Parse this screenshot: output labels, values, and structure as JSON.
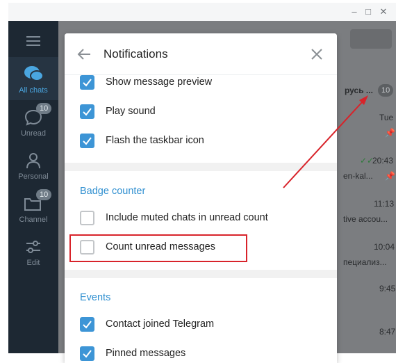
{
  "window": {
    "minimize_icon": "minimize-icon",
    "maximize_icon": "maximize-icon",
    "close_icon": "close-icon"
  },
  "sidebar": {
    "items": [
      {
        "label": "All chats",
        "icon": "chats-icon",
        "badge": ""
      },
      {
        "label": "Unread",
        "icon": "chat-bubble-icon",
        "badge": "10"
      },
      {
        "label": "Personal",
        "icon": "person-icon",
        "badge": ""
      },
      {
        "label": "Channel",
        "icon": "folder-icon",
        "badge": "10"
      },
      {
        "label": "Edit",
        "icon": "sliders-icon",
        "badge": ""
      }
    ]
  },
  "chat_bg": {
    "title_fragment": "русь ...",
    "badge": "10",
    "times": [
      "Tue",
      "20:43",
      "11:13",
      "10:04",
      "9:45",
      "8:47"
    ],
    "snippets": [
      "en-kal...",
      "tive accou...",
      "пециализ..."
    ]
  },
  "modal": {
    "title": "Notifications",
    "rows_top": [
      {
        "label": "Show message preview",
        "checked": true
      },
      {
        "label": "Play sound",
        "checked": true
      },
      {
        "label": "Flash the taskbar icon",
        "checked": true
      }
    ],
    "badge_section": {
      "title": "Badge counter",
      "rows": [
        {
          "label": "Include muted chats in unread count",
          "checked": false
        },
        {
          "label": "Count unread messages",
          "checked": false
        }
      ]
    },
    "events_section": {
      "title": "Events",
      "rows": [
        {
          "label": "Contact joined Telegram",
          "checked": true
        },
        {
          "label": "Pinned messages",
          "checked": true
        }
      ]
    }
  },
  "colors": {
    "accent": "#3d95d6",
    "annotation": "#d8232a",
    "sidebar_bg": "#1d2833"
  }
}
